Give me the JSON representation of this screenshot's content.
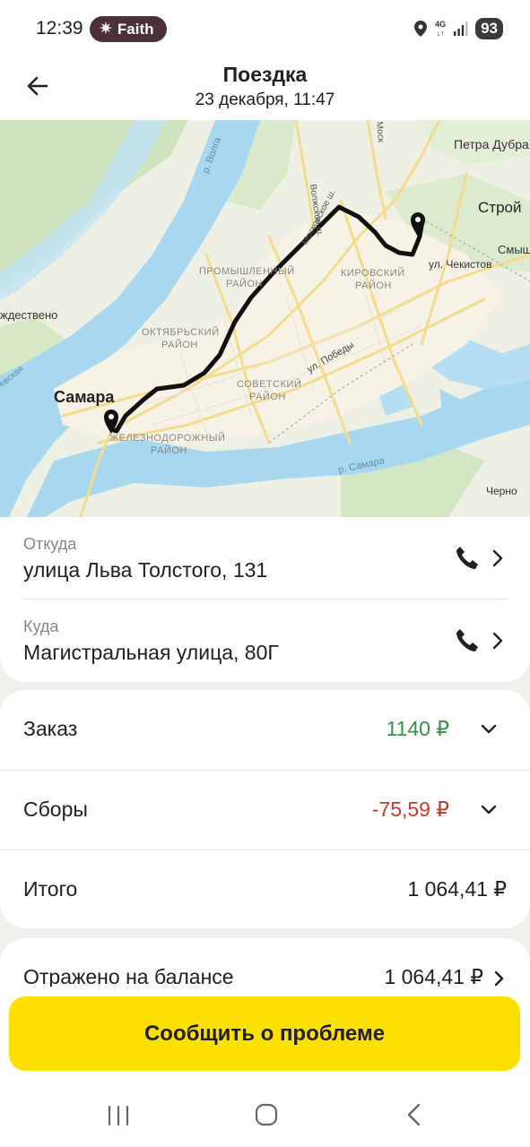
{
  "status_bar": {
    "time": "12:39",
    "pill_label": "Faith",
    "network_type_top": "4G",
    "network_type_bottom": "↓↑",
    "battery": "93",
    "icons": [
      "sparkle-icon",
      "location-icon",
      "signal-icon"
    ]
  },
  "header": {
    "title": "Поездка",
    "subtitle": "23 декабря, 11:47",
    "back_icon": "arrow-left-icon"
  },
  "map": {
    "labels": {
      "volga": "р. Волга",
      "rozhdestveno": "ждествено",
      "samara_city": "Самара",
      "petra_dubrava": "Петра Дубра",
      "stroy": "Строй",
      "smysh": "Смыш",
      "chekistov": "ул. Чекистов",
      "promyshl_1": "ПРОМЫШЛЕННЫЙ",
      "promyshl_2": "РАЙОН",
      "kirov_1": "КИРОВСКИЙ",
      "kirov_2": "РАЙОН",
      "oktyabr_1": "ОКТЯБРЬСКИЙ",
      "oktyabr_2": "РАЙОН",
      "sovet_1": "СОВЕТСКИЙ",
      "sovet_2": "РАЙОН",
      "zhd_1": "ЖЕЛЕЗНОДОРОЖНЫЙ",
      "zhd_2": "РАЙОН",
      "pobedy": "ул. Победы",
      "samara_river": "р. Самара",
      "cherno": "Черно",
      "moskovskoe": "Московское ш.",
      "volzhskoe": "Волжское ш.",
      "mosk_top": "Моск",
      "veiskaya": "евская"
    },
    "colors": {
      "route": "#111111",
      "water": "#a8d8f0",
      "land": "#eef0e4",
      "forest": "#cfe3bf",
      "road": "#f7e4a8"
    }
  },
  "trip": {
    "from_label": "Откуда",
    "from_address": "улица Льва Толстого, 131",
    "to_label": "Куда",
    "to_address": "Магистральная улица, 80Г"
  },
  "summary": {
    "order_label": "Заказ",
    "order_value": "1140 ₽",
    "fees_label": "Сборы",
    "fees_value": "-75,59 ₽",
    "total_label": "Итого",
    "total_value": "1 064,41 ₽",
    "balance_label": "Отражено на балансе",
    "balance_value": "1 064,41 ₽"
  },
  "colors": {
    "positive": "#3a8f4f",
    "negative": "#c23a2e",
    "accent_button": "#fce000"
  },
  "actions": {
    "report_button": "Сообщить о проблеме"
  },
  "nav": {
    "icons": [
      "recent-apps-icon",
      "home-icon",
      "back-icon"
    ]
  }
}
